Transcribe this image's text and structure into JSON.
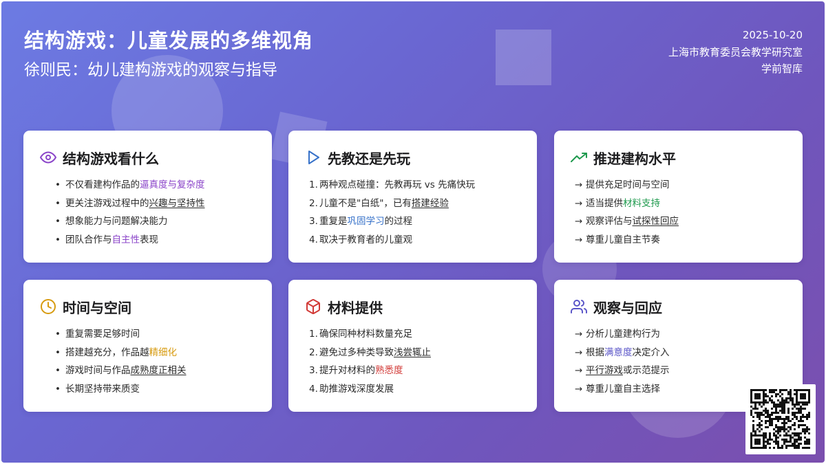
{
  "header": {
    "title": "结构游戏：儿童发展的多维视角",
    "subtitle": "徐则民：幼儿建构游戏的观察与指导",
    "date": "2025-10-20",
    "organization": "上海市教育委员会教学研究室",
    "source": "学前智库"
  },
  "colors": {
    "bg_start": "#6c7be3",
    "bg_end": "#7b4fae",
    "purple": "#8b45c9",
    "blue": "#3671c9",
    "green": "#1f9a4e",
    "orange": "#d79b10",
    "red": "#d23a37",
    "indigo": "#5a55c8"
  },
  "cards": [
    {
      "icon": "eye-icon",
      "title": "结构游戏看什么",
      "list_style": "bullet",
      "items": [
        {
          "pre": "不仅看建构作品的",
          "hl": "逼真度与复杂度",
          "post": "",
          "cls": "hl-purple"
        },
        {
          "pre": "更关注游戏过程中的",
          "hl": "兴趣与坚持性",
          "post": "",
          "cls": "ul"
        },
        {
          "pre": "想象能力与问题解决能力",
          "hl": "",
          "post": "",
          "cls": ""
        },
        {
          "pre": "团队合作与",
          "hl": "自主性",
          "post": "表现",
          "cls": "hl-purple"
        }
      ]
    },
    {
      "icon": "play-icon",
      "title": "先教还是先玩",
      "list_style": "number",
      "items": [
        {
          "pre": "两种观点碰撞：先教再玩 vs 先痛快玩",
          "hl": "",
          "post": "",
          "cls": ""
        },
        {
          "pre": "儿童不是\"白纸\"，已有",
          "hl": "搭建经验",
          "post": "",
          "cls": "ul"
        },
        {
          "pre": "重复是",
          "hl": "巩固学习",
          "post": "的过程",
          "cls": "hl-blue"
        },
        {
          "pre": "取决于教育者的儿童观",
          "hl": "",
          "post": "",
          "cls": ""
        }
      ]
    },
    {
      "icon": "trending-up-icon",
      "title": "推进建构水平",
      "list_style": "arrow",
      "items": [
        {
          "pre": "提供充足时间与空间",
          "hl": "",
          "post": "",
          "cls": ""
        },
        {
          "pre": "适当提供",
          "hl": "材料支持",
          "post": "",
          "cls": "hl-green"
        },
        {
          "pre": "观察评估与",
          "hl": "试探性回应",
          "post": "",
          "cls": "ul"
        },
        {
          "pre": "尊重儿童自主节奏",
          "hl": "",
          "post": "",
          "cls": ""
        }
      ]
    },
    {
      "icon": "clock-icon",
      "title": "时间与空间",
      "list_style": "bullet",
      "items": [
        {
          "pre": "重复需要足够时间",
          "hl": "",
          "post": "",
          "cls": ""
        },
        {
          "pre": "搭建越充分，作品越",
          "hl": "精细化",
          "post": "",
          "cls": "hl-orange"
        },
        {
          "pre": "游戏时间与作品",
          "hl": "成熟度正相关",
          "post": "",
          "cls": "ul"
        },
        {
          "pre": "长期坚持带来质变",
          "hl": "",
          "post": "",
          "cls": ""
        }
      ]
    },
    {
      "icon": "box-icon",
      "title": "材料提供",
      "list_style": "number",
      "items": [
        {
          "pre": "确保同种材料数量充足",
          "hl": "",
          "post": "",
          "cls": ""
        },
        {
          "pre": "避免过多种类导致",
          "hl": "浅尝辄止",
          "post": "",
          "cls": "ul"
        },
        {
          "pre": "提升对材料的",
          "hl": "熟悉度",
          "post": "",
          "cls": "hl-red"
        },
        {
          "pre": "助推游戏深度发展",
          "hl": "",
          "post": "",
          "cls": ""
        }
      ]
    },
    {
      "icon": "users-icon",
      "title": "观察与回应",
      "list_style": "arrow",
      "items": [
        {
          "pre": "分析儿童建构行为",
          "hl": "",
          "post": "",
          "cls": ""
        },
        {
          "pre": "根据",
          "hl": "满意度",
          "post": "决定介入",
          "cls": "hl-indigo"
        },
        {
          "pre": "",
          "hl": "平行游戏",
          "post": "或示范提示",
          "cls": "ul"
        },
        {
          "pre": "尊重儿童自主选择",
          "hl": "",
          "post": "",
          "cls": ""
        }
      ]
    }
  ],
  "qr": {
    "icon": "qr-code-icon"
  }
}
